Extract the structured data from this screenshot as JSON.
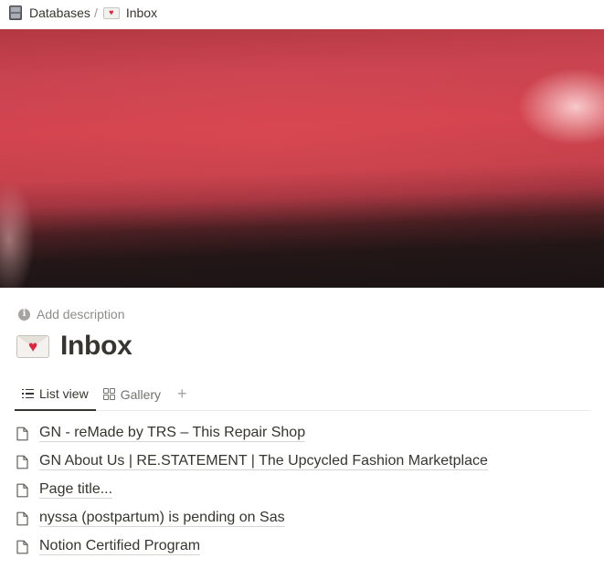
{
  "breadcrumb": {
    "items": [
      {
        "label": "Databases",
        "icon": "file-cabinet-icon"
      },
      {
        "label": "Inbox",
        "icon": "love-letter-icon"
      }
    ],
    "separator": "/"
  },
  "cover": {
    "colors": {
      "primary": "#c94450",
      "dark": "#1a1414"
    }
  },
  "description": {
    "label": "Add description"
  },
  "page": {
    "icon": "love-letter-icon",
    "title": "Inbox"
  },
  "views": {
    "tabs": [
      {
        "label": "List view",
        "icon": "list-icon",
        "active": true
      },
      {
        "label": "Gallery",
        "icon": "gallery-icon",
        "active": false
      }
    ],
    "add_symbol": "+"
  },
  "items": [
    {
      "title": "GN - reMade by TRS – This Repair Shop",
      "icon": "page-icon"
    },
    {
      "title": "GN About Us | RE.STATEMENT | The Upcycled Fashion Marketplace",
      "icon": "page-icon"
    },
    {
      "title": "Page title...",
      "icon": "page-icon"
    },
    {
      "title": "nyssa (postpartum) is pending on Sas",
      "icon": "page-icon"
    },
    {
      "title": "Notion Certified Program",
      "icon": "page-icon"
    }
  ]
}
